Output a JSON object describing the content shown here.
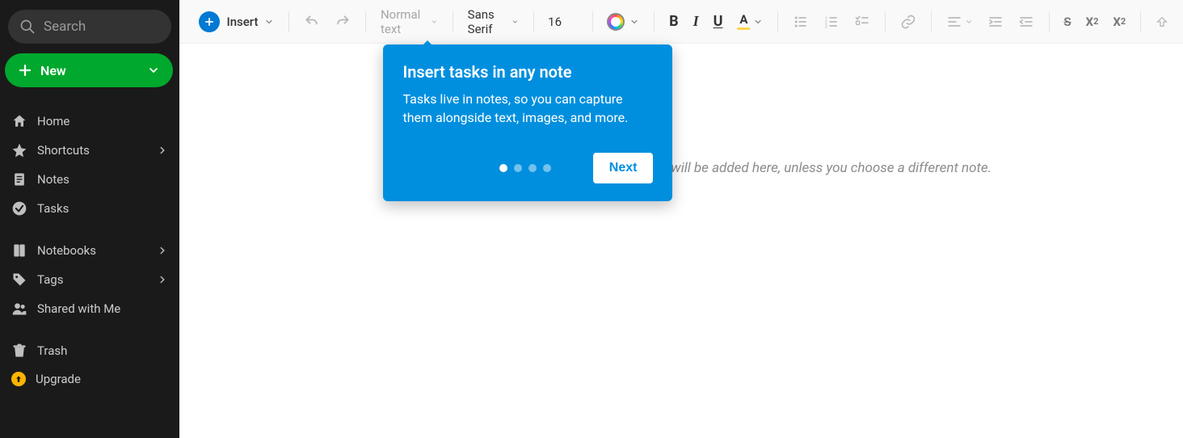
{
  "sidebar": {
    "search_placeholder": "Search",
    "new_button": "New",
    "items": [
      {
        "label": "Home"
      },
      {
        "label": "Shortcuts"
      },
      {
        "label": "Notes"
      },
      {
        "label": "Tasks"
      },
      {
        "label": "Notebooks"
      },
      {
        "label": "Tags"
      },
      {
        "label": "Shared with Me"
      },
      {
        "label": "Trash"
      },
      {
        "label": "Upgrade"
      }
    ]
  },
  "toolbar": {
    "insert_label": "Insert",
    "paragraph_style": "Normal text",
    "font_family": "Sans Serif",
    "font_size": "16",
    "bold": "B",
    "italic": "I",
    "underline": "U",
    "text_color": "A",
    "strike": "S",
    "superscript": "X",
    "subscript": "X"
  },
  "editor": {
    "placeholder_text": "Tasks you add from the create button will be added here, unless you choose a different note."
  },
  "popover": {
    "title": "Insert tasks in any note",
    "body": "Tasks live in notes, so you can capture them alongside text, images, and more.",
    "step_count": 4,
    "active_step": 1,
    "next_label": "Next"
  }
}
